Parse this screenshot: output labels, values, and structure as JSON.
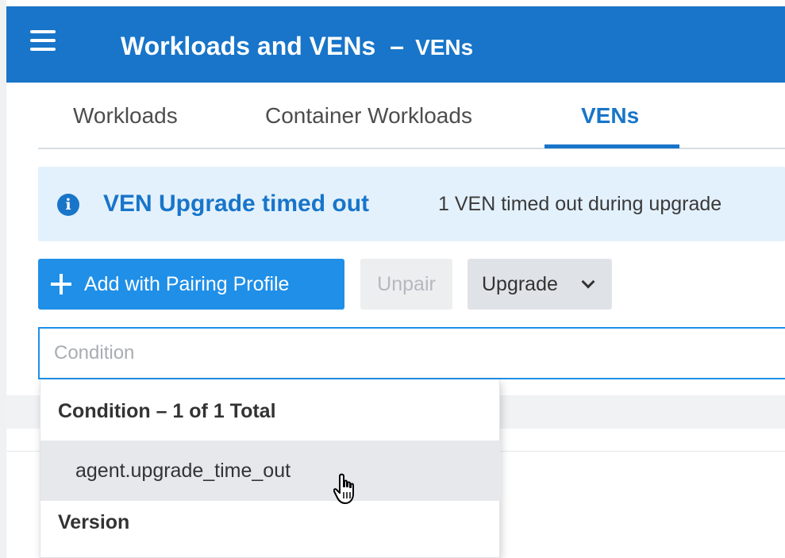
{
  "header": {
    "title": "Workloads and VENs",
    "separator": "–",
    "subtitle": "VENs",
    "background_color": "#1875c9"
  },
  "tabs": [
    {
      "label": "Workloads",
      "active": false
    },
    {
      "label": "Container Workloads",
      "active": false
    },
    {
      "label": "VENs",
      "active": true
    }
  ],
  "banner": {
    "icon": "info-icon",
    "title": "VEN Upgrade timed out",
    "message": "1 VEN timed out during upgrade"
  },
  "toolbar": {
    "add_label": "Add with Pairing Profile",
    "unpair_label": "Unpair",
    "upgrade_label": "Upgrade"
  },
  "search": {
    "placeholder": "Condition",
    "value": ""
  },
  "dropdown": {
    "sections": [
      {
        "header": "Condition – 1 of 1 Total",
        "options": [
          "agent.upgrade_time_out"
        ]
      },
      {
        "header": "Version",
        "options": []
      }
    ]
  }
}
